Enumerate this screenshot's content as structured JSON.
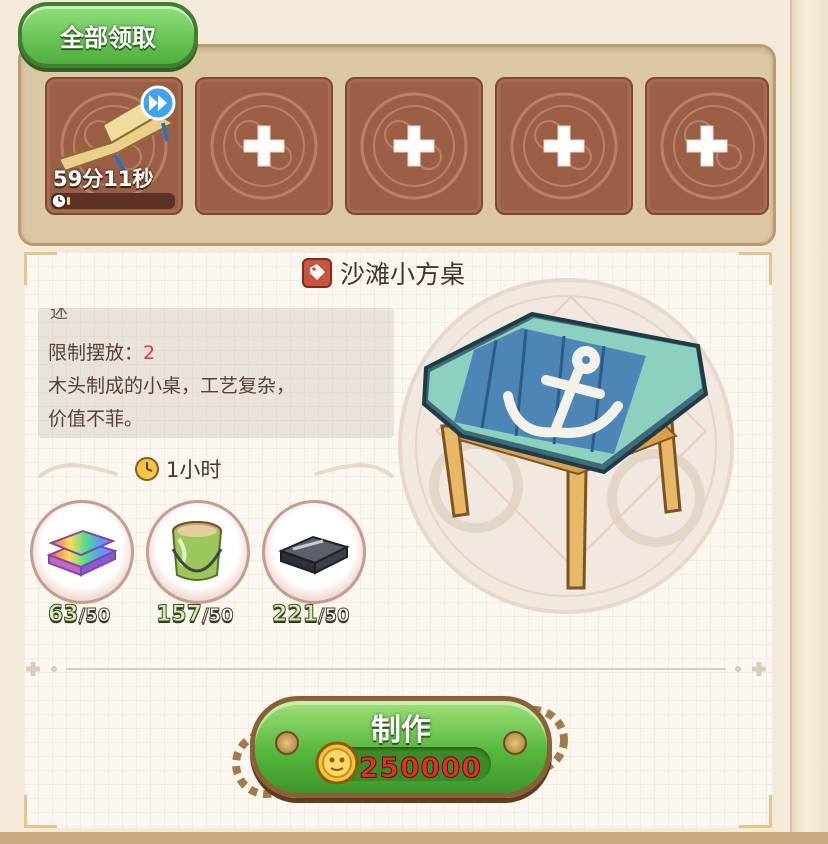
{
  "claim_all": {
    "label": "全部领取"
  },
  "queue": {
    "active_slot": {
      "timer": "59分11秒",
      "progress": 0.03
    },
    "empty_slot_count": 4
  },
  "item": {
    "name": "沙滩小方桌",
    "desc_cut": "述",
    "limit_label": "限制摆放：",
    "limit_value": "2",
    "description_line1": "木头制成的小桌，工艺复杂，",
    "description_line2": "价值不菲。",
    "craft_time": "1小时"
  },
  "materials": [
    {
      "icon": "rainbow-ingot-icon",
      "have": "63",
      "need": "/50"
    },
    {
      "icon": "paint-bucket-icon",
      "have": "157",
      "need": "/50"
    },
    {
      "icon": "iron-ingot-icon",
      "have": "221",
      "need": "/50"
    }
  ],
  "craft": {
    "label": "制作",
    "cost": "250000"
  },
  "colors": {
    "accent_green": "#56b83c",
    "cost_red": "#e0302f",
    "limit_red": "#e5393b"
  }
}
